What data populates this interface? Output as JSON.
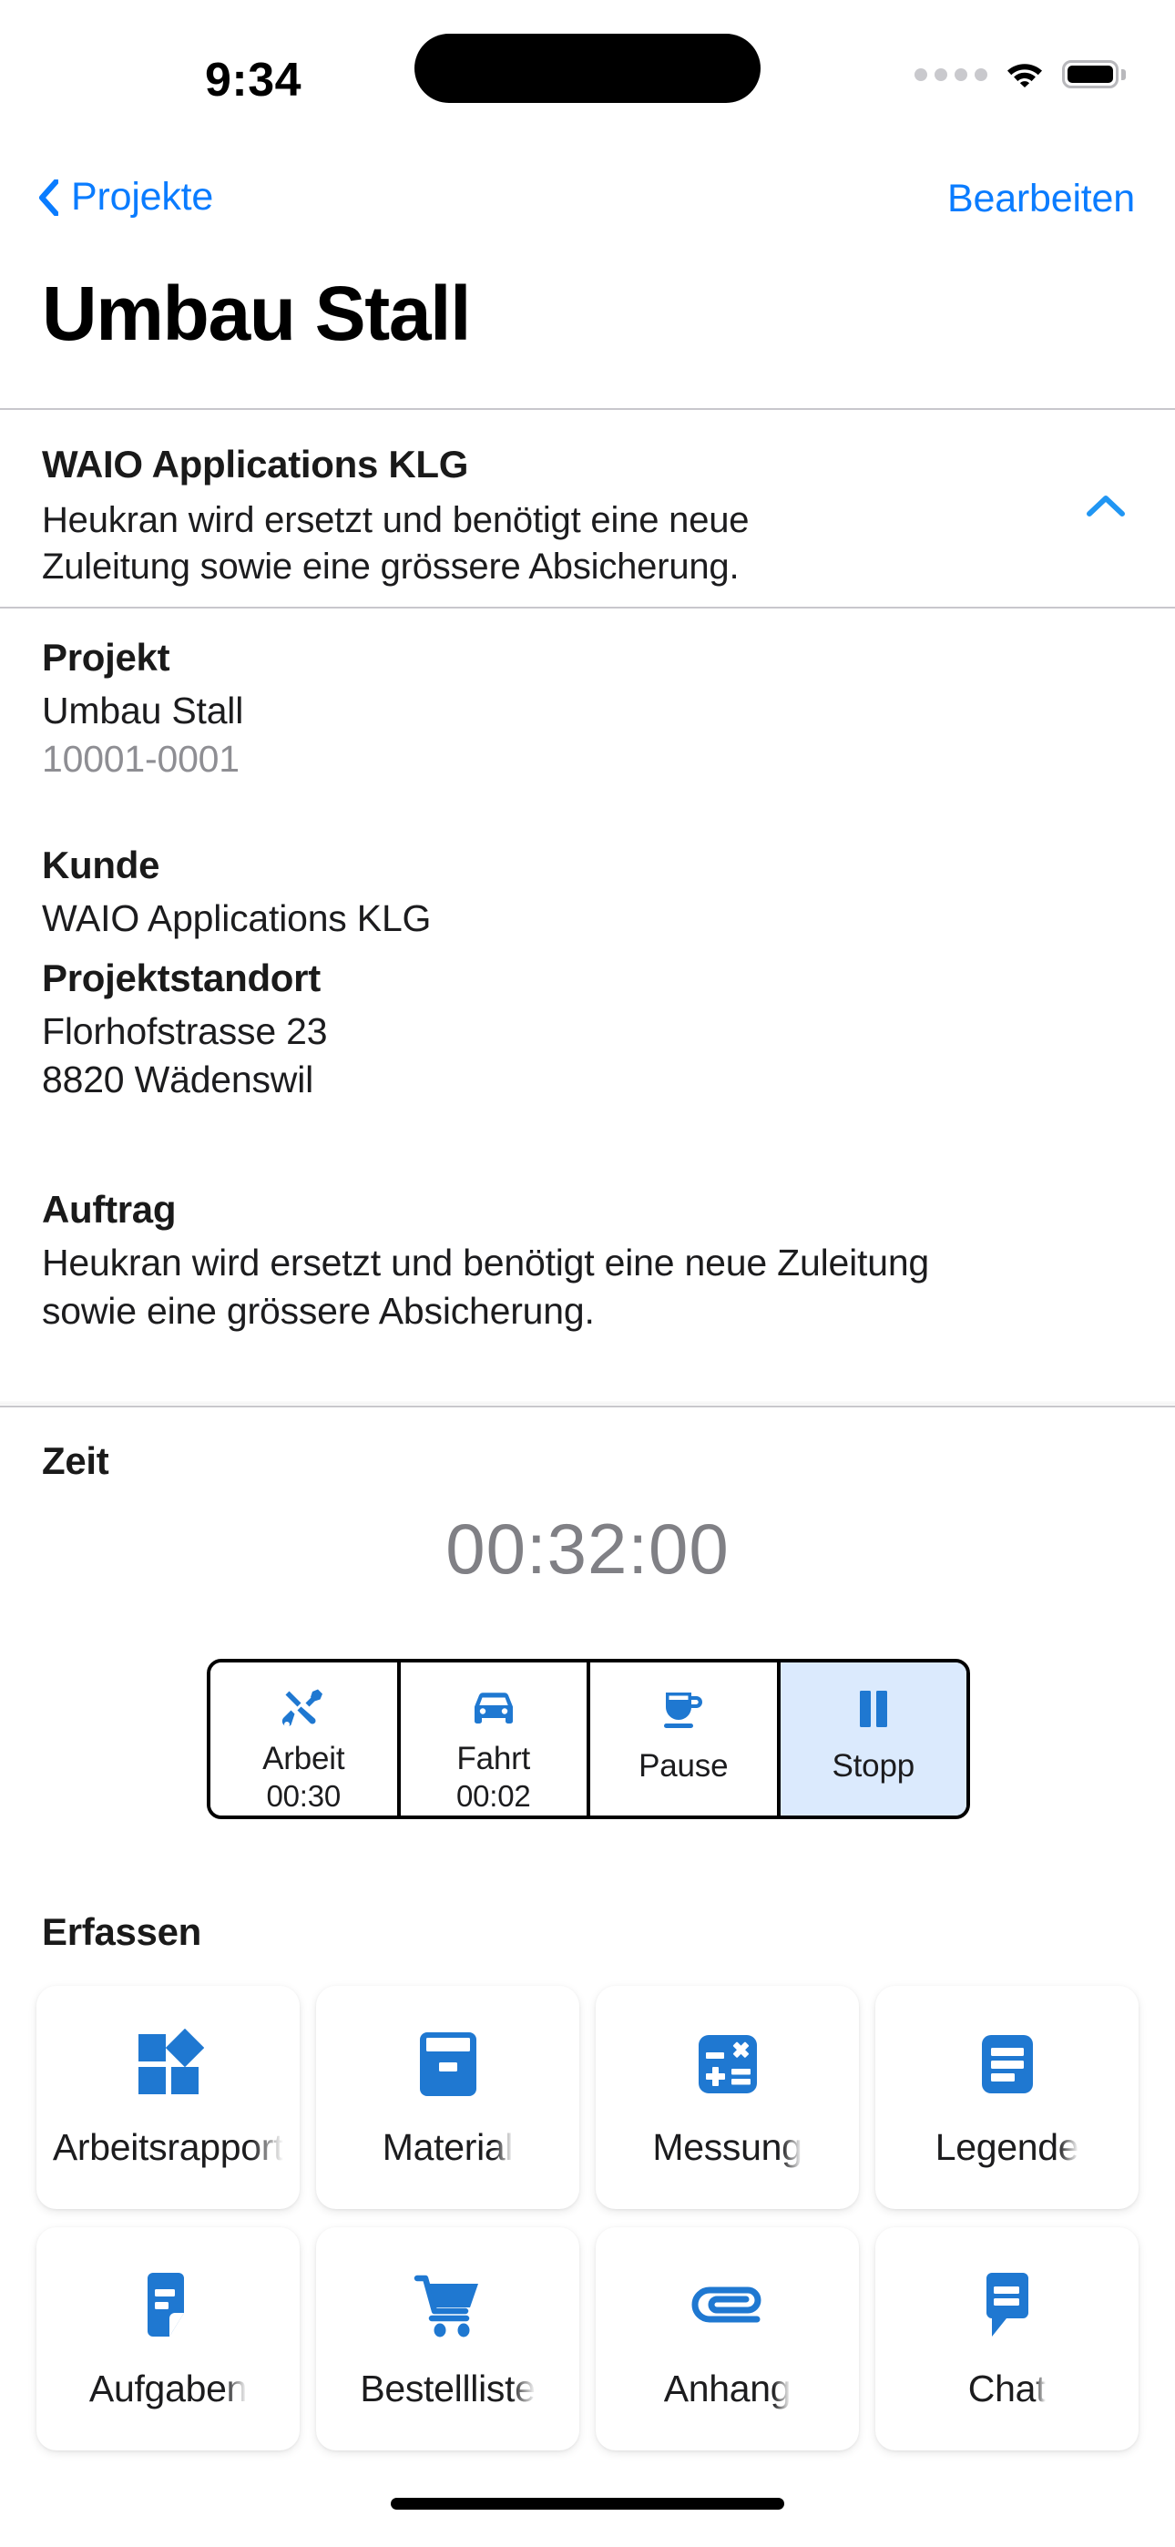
{
  "status_bar": {
    "time": "9:34",
    "cellular_icon": "signal-dots-icon",
    "wifi_icon": "wifi-icon",
    "battery_icon": "battery-full-icon"
  },
  "nav": {
    "back_label": "Projekte",
    "back_icon": "chevron-left-icon",
    "edit_label": "Bearbeiten"
  },
  "page_title": "Umbau Stall",
  "summary": {
    "title": "WAIO Applications KLG",
    "description": "Heukran wird ersetzt und benötigt eine neue Zuleitung sowie eine grössere Absicherung.",
    "collapse_icon": "chevron-up-icon"
  },
  "details": [
    {
      "label": "Projekt",
      "value": "Umbau Stall",
      "sub": "10001-0001"
    },
    {
      "label": "Kunde",
      "value": "WAIO Applications KLG",
      "sub": ""
    },
    {
      "label": "Projektstandort",
      "value": "Florhofstrasse 23",
      "sub2": "8820 Wädenswil"
    },
    {
      "label": "Auftrag",
      "value": "Heukran wird ersetzt und benötigt eine neue Zuleitung sowie eine grössere Absicherung."
    }
  ],
  "time_section": {
    "label": "Zeit",
    "elapsed": "00:32:00",
    "segments": [
      {
        "label": "Arbeit",
        "time": "00:30",
        "icon": "tools-hammer-wrench-icon",
        "active": false
      },
      {
        "label": "Fahrt",
        "time": "00:02",
        "icon": "car-icon",
        "active": false
      },
      {
        "label": "Pause",
        "time": "",
        "icon": "coffee-cup-icon",
        "active": false
      },
      {
        "label": "Stopp",
        "time": "",
        "icon": "pause-bars-icon",
        "active": true
      }
    ]
  },
  "capture_section": {
    "label": "Erfassen",
    "tiles": [
      {
        "label": "Arbeitsrapport",
        "icon": "grid-diamond-icon"
      },
      {
        "label": "Material",
        "icon": "archive-box-icon"
      },
      {
        "label": "Messung",
        "icon": "calculator-icon"
      },
      {
        "label": "Legende",
        "icon": "article-lines-icon"
      },
      {
        "label": "Aufgaben",
        "icon": "note-task-icon"
      },
      {
        "label": "Bestellliste",
        "icon": "shopping-cart-icon"
      },
      {
        "label": "Anhang",
        "icon": "paperclip-icon"
      },
      {
        "label": "Chat",
        "icon": "chat-bubble-icon"
      }
    ]
  },
  "colors": {
    "accent": "#0a7cff",
    "icon_blue": "#1f78d1",
    "active_segment_bg": "#dbeafd",
    "muted_text": "#8e8e93",
    "timer_text": "#808085"
  },
  "home_indicator": "home-indicator"
}
